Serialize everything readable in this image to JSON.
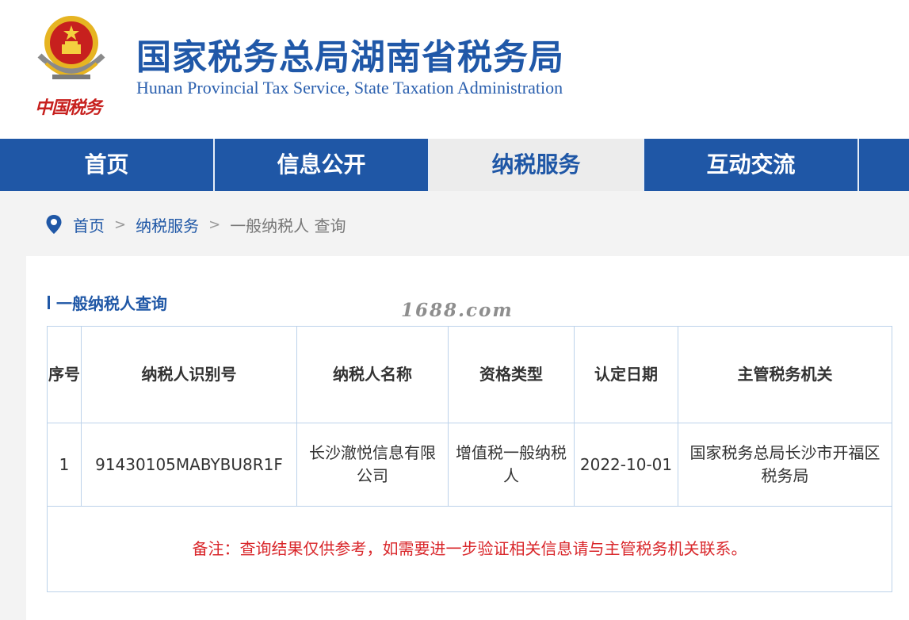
{
  "header": {
    "title_cn": "国家税务总局湖南省税务局",
    "title_en": "Hunan Provincial  Tax Service,  State Taxation Administration",
    "logo_text": "中国税务",
    "emblem_icon": "national-emblem-icon"
  },
  "nav": {
    "items": [
      {
        "label": "首页"
      },
      {
        "label": "信息公开"
      },
      {
        "label": "纳税服务",
        "active": true
      },
      {
        "label": "互动交流"
      }
    ]
  },
  "breadcrumb": {
    "icon": "location-pin-icon",
    "home": "首页",
    "section": "纳税服务",
    "current": "一般纳税人 查询",
    "separator": ">"
  },
  "watermark": "1688.com",
  "query": {
    "section_title": "一般纳税人查询",
    "columns": [
      "序号",
      "纳税人识别号",
      "纳税人名称",
      "资格类型",
      "认定日期",
      "主管税务机关"
    ],
    "rows": [
      [
        "1",
        "91430105MABYBU8R1F",
        "长沙澈悦信息有限公司",
        "增值税一般纳税人",
        "2022-10-01",
        "国家税务总局长沙市开福区税务局"
      ]
    ],
    "note": "备注：查询结果仅供参考，如需要进一步验证相关信息请与主管税务机关联系。"
  },
  "colors": {
    "primary_blue": "#1f57a6",
    "nav_active_bg": "#ececec",
    "note_red": "#d9262a",
    "emblem_red": "#c7201e",
    "emblem_gold": "#e6b422"
  }
}
